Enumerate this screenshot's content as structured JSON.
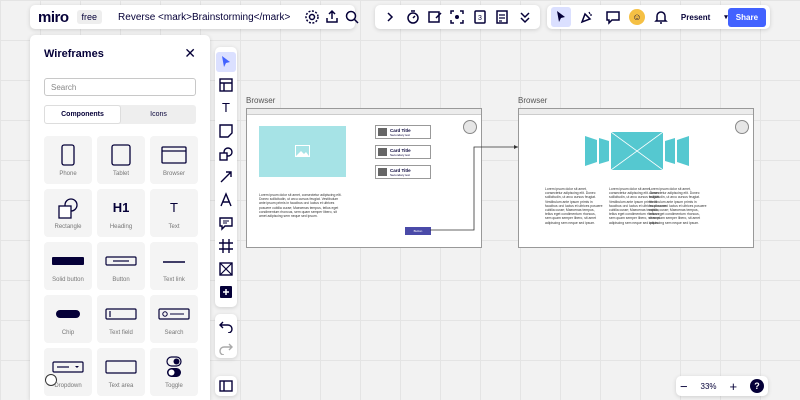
{
  "app": {
    "logo": "miro",
    "plan": "free",
    "board_title": "Reverse <mark>Brainstorming</mark>"
  },
  "top_right": {
    "present_label": "Present",
    "share_label": "Share",
    "avatar_initial": "☺"
  },
  "panel": {
    "title": "Wireframes",
    "search_placeholder": "Search",
    "tabs": [
      "Components",
      "Icons"
    ],
    "items": [
      "Phone",
      "Tablet",
      "Browser",
      "Rectangle",
      "Heading",
      "Text",
      "Solid button",
      "Button",
      "Text link",
      "Chip",
      "Text field",
      "Search",
      "Dropdown",
      "Text area",
      "Toggle"
    ],
    "heading_glyph": "H1",
    "text_glyph": "T"
  },
  "canvas": {
    "frame1_label": "Browser",
    "frame2_label": "Browser",
    "cards": [
      {
        "title": "Card Title",
        "sub": "Secondary text"
      },
      {
        "title": "Card Title",
        "sub": "Secondary text"
      },
      {
        "title": "Card Title",
        "sub": "Secondary text"
      }
    ],
    "button_text": "Button",
    "lorem": "Lorem ipsum dolor sit amet, consectetur adipiscing elit. Donec sollicitudin, ut arcu cursus feugiat. Vestibulum ante ipsum primis in faucibus orci luctus et ultrices posuere cubilia curae; Maecenas tempus, tellus eget condimentum rhoncus, sem quam semper libero, sit amet adipiscing sem neque sed ipsum."
  },
  "zoom": {
    "minus": "−",
    "level": "33%",
    "plus": "+",
    "help": "?"
  }
}
